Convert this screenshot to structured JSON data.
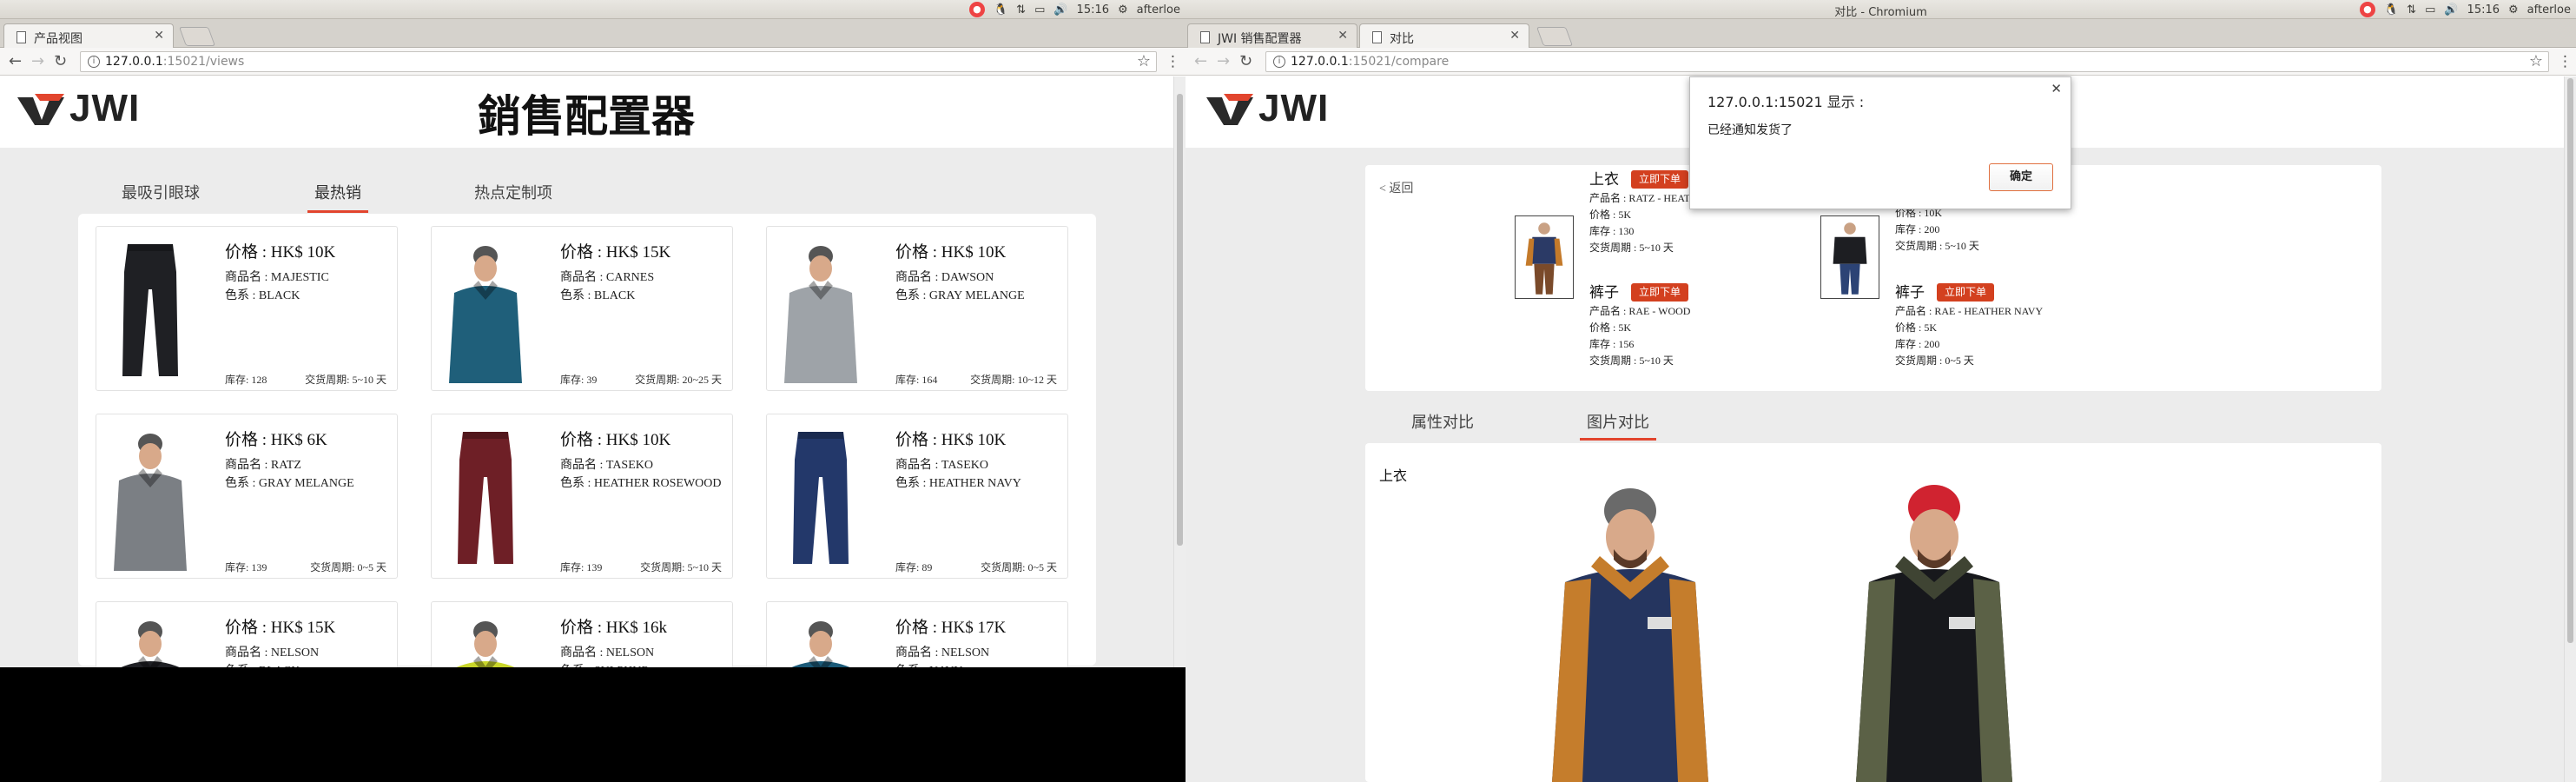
{
  "left": {
    "titlebar_user": "afterloe",
    "clock": "15:16",
    "tab_title": "产品视图",
    "url_host": "127.0.0.1",
    "url_rest": ":15021/views",
    "page_title": "銷售配置器",
    "logo_text": "JWI",
    "tabs": [
      "最吸引眼球",
      "最热销",
      "热点定制项"
    ],
    "products": [
      {
        "price": "价格 : HK$ 10K",
        "name": "商品名 : MAJESTIC",
        "color": "色系 : BLACK",
        "stock": "库存: 128",
        "lead": "交货周期: 5~10 天",
        "kind": "pants",
        "tint": "#1f2024"
      },
      {
        "price": "价格 : HK$ 15K",
        "name": "商品名 : CARNES",
        "color": "色系 : BLACK",
        "stock": "库存: 39",
        "lead": "交货周期: 20~25 天",
        "kind": "jacket",
        "tint": "#1f5f7a"
      },
      {
        "price": "价格 : HK$ 10K",
        "name": "商品名 : DAWSON",
        "color": "色系 : GRAY MELANGE",
        "stock": "库存: 164",
        "lead": "交货周期: 10~12 天",
        "kind": "jacket",
        "tint": "#9ea3a8"
      },
      {
        "price": "价格 : HK$ 6K",
        "name": "商品名 : RATZ",
        "color": "色系 : GRAY MELANGE",
        "stock": "库存: 139",
        "lead": "交货周期: 0~5 天",
        "kind": "jacket",
        "tint": "#7b7f84"
      },
      {
        "price": "价格 : HK$ 10K",
        "name": "商品名 : TASEKO",
        "color": "色系 : HEATHER ROSEWOOD",
        "stock": "库存: 139",
        "lead": "交货周期: 5~10 天",
        "kind": "pants",
        "tint": "#6e1f26"
      },
      {
        "price": "价格 : HK$ 10K",
        "name": "商品名 : TASEKO",
        "color": "色系 : HEATHER NAVY",
        "stock": "库存: 89",
        "lead": "交货周期: 0~5 天",
        "kind": "pants",
        "tint": "#23386a"
      },
      {
        "price": "价格 : HK$ 15K",
        "name": "商品名 : NELSON",
        "color": "色系 : BLACK",
        "stock": "",
        "lead": "",
        "kind": "jacket",
        "tint": "#1f2024"
      },
      {
        "price": "价格 : HK$ 16k",
        "name": "商品名 : NELSON",
        "color": "色系 : SULPHUR",
        "stock": "",
        "lead": "",
        "kind": "jacket",
        "tint": "#c9d62a"
      },
      {
        "price": "价格 : HK$ 17K",
        "name": "商品名 : NELSON",
        "color": "色系 : NAVY",
        "stock": "",
        "lead": "",
        "kind": "jacket",
        "tint": "#1b5a78"
      }
    ]
  },
  "right": {
    "window_title": "对比 - Chromium",
    "tab1": "JWI 销售配置器",
    "tab2": "对比",
    "url_host": "127.0.0.1",
    "url_rest": ":15021/compare",
    "back": "< 返回",
    "sets": [
      {
        "top": {
          "heading": "上衣",
          "order": "立即下单",
          "name": "产品名 : RATZ - HEATHER",
          "price": "价格 : 5K",
          "stock": "库存 : 130",
          "lead": "交货周期 : 5~10 天"
        },
        "bottom": {
          "heading": "裤子",
          "order": "立即下单",
          "name": "产品名 : RAE - WOOD",
          "price": "价格 : 5K",
          "stock": "库存 : 156",
          "lead": "交货周期 : 5~10 天"
        }
      },
      {
        "top": {
          "heading": "",
          "order": "",
          "name": "",
          "price": "价格 : 10K",
          "stock": "库存 : 200",
          "lead": "交货周期 : 5~10 天"
        },
        "bottom": {
          "heading": "裤子",
          "order": "立即下单",
          "name": "产品名 : RAE - HEATHER NAVY",
          "price": "价格 : 5K",
          "stock": "库存 : 200",
          "lead": "交货周期 : 0~5 天"
        }
      }
    ],
    "tabs": [
      "属性对比",
      "图片对比"
    ],
    "image_section": "上衣",
    "dialog": {
      "title": "127.0.0.1:15021 显示 :",
      "message": "已经通知发货了",
      "ok": "确定"
    }
  },
  "colors": {
    "accent": "#e2452e",
    "order": "#d3401f"
  }
}
